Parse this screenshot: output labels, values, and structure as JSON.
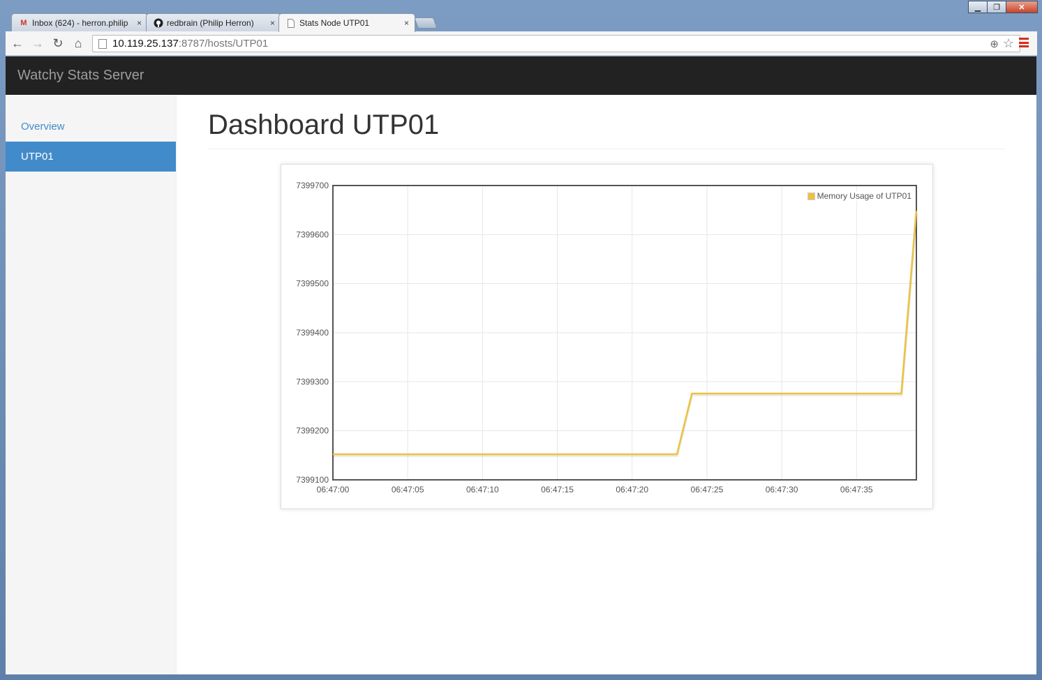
{
  "browser": {
    "tabs": [
      {
        "title": "Inbox (624) - herron.philip",
        "icon": "gmail-icon",
        "active": false
      },
      {
        "title": "redbrain (Philip Herron)",
        "icon": "github-icon",
        "active": false
      },
      {
        "title": "Stats Node UTP01",
        "icon": "page-icon",
        "active": true
      }
    ],
    "close_glyph": "×",
    "address": {
      "host": "10.119.25.137",
      "path": ":8787/hosts/UTP01"
    }
  },
  "navbar": {
    "brand": "Watchy Stats Server"
  },
  "sidebar": {
    "items": [
      {
        "label": "Overview",
        "active": false
      },
      {
        "label": "UTP01",
        "active": true
      }
    ]
  },
  "main": {
    "title": "Dashboard UTP01"
  },
  "chart_data": {
    "type": "line",
    "title": "",
    "xlabel": "",
    "ylabel": "",
    "x_ticks": [
      "06:47:00",
      "06:47:05",
      "06:47:10",
      "06:47:15",
      "06:47:20",
      "06:47:25",
      "06:47:30",
      "06:47:35"
    ],
    "y_ticks": [
      7399100,
      7399200,
      7399300,
      7399400,
      7399500,
      7399600,
      7399700
    ],
    "xlim": [
      "06:47:00",
      "06:47:39"
    ],
    "ylim": [
      7399100,
      7399700
    ],
    "grid": true,
    "legend_position": "top-right",
    "series": [
      {
        "name": "Memory Usage of UTP01",
        "color": "#edc240",
        "points": [
          {
            "x": "06:47:00",
            "y": 7399152
          },
          {
            "x": "06:47:23",
            "y": 7399152
          },
          {
            "x": "06:47:24",
            "y": 7399276
          },
          {
            "x": "06:47:38",
            "y": 7399276
          },
          {
            "x": "06:47:39",
            "y": 7399648
          }
        ]
      }
    ]
  }
}
